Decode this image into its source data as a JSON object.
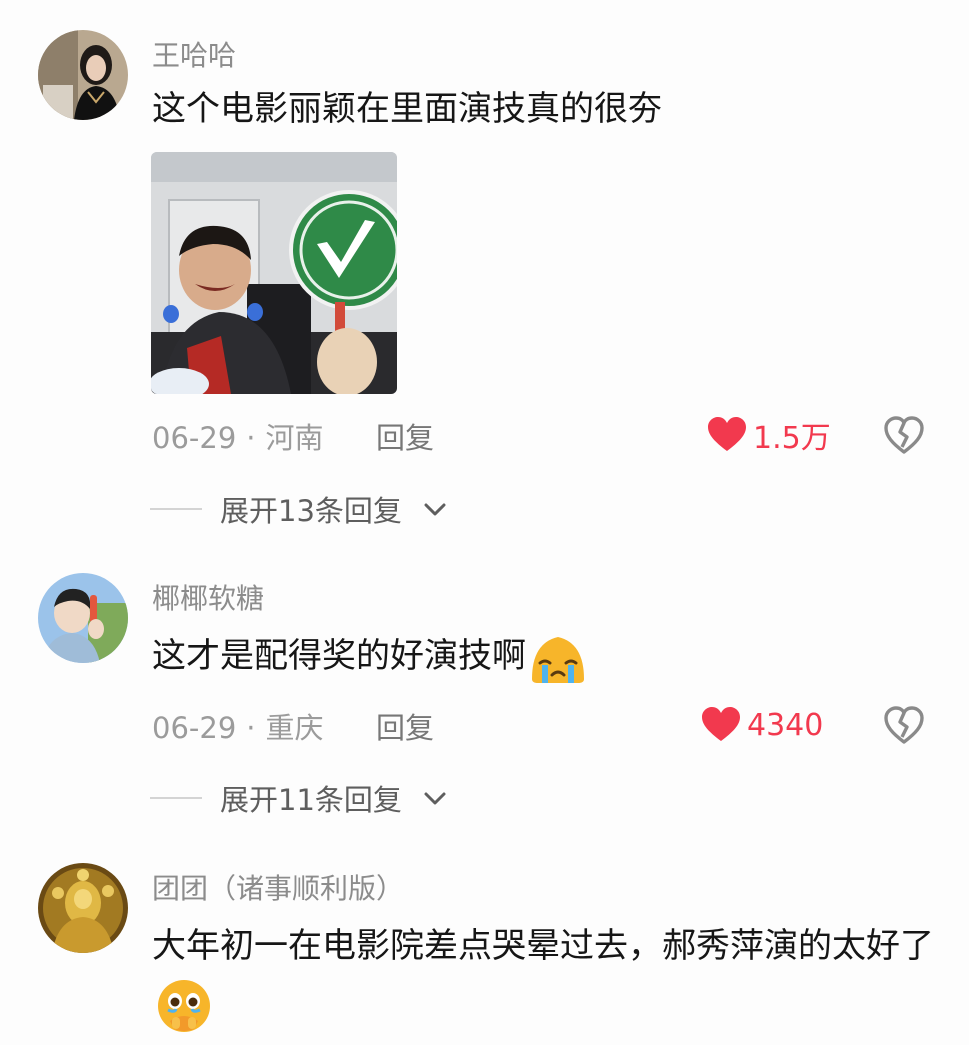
{
  "comments": [
    {
      "username": "王哈哈",
      "text": "这个电影丽颖在里面演技真的很夯",
      "has_image": true,
      "date": "06-29",
      "location": "河南",
      "reply_label": "回复",
      "likes": "1.5万",
      "expand_label": "展开13条回复"
    },
    {
      "username": "椰椰软糖",
      "text": "这才是配得奖的好演技啊",
      "emoji": "crying-face-emoji",
      "date": "06-29",
      "location": "重庆",
      "reply_label": "回复",
      "likes": "4340",
      "expand_label": "展开11条回复"
    },
    {
      "username": "团团（诸事顺利版）",
      "text": "大年初一在电影院差点哭晕过去，郝秀萍演的太好了",
      "emoji": "holding-back-tears-emoji"
    }
  ],
  "separator": "·",
  "colors": {
    "like": "#f2394e",
    "meta": "#9b9b9b",
    "username": "#8c8c8c"
  },
  "icons": [
    "heart-icon",
    "broken-heart-icon",
    "chevron-down-icon"
  ]
}
